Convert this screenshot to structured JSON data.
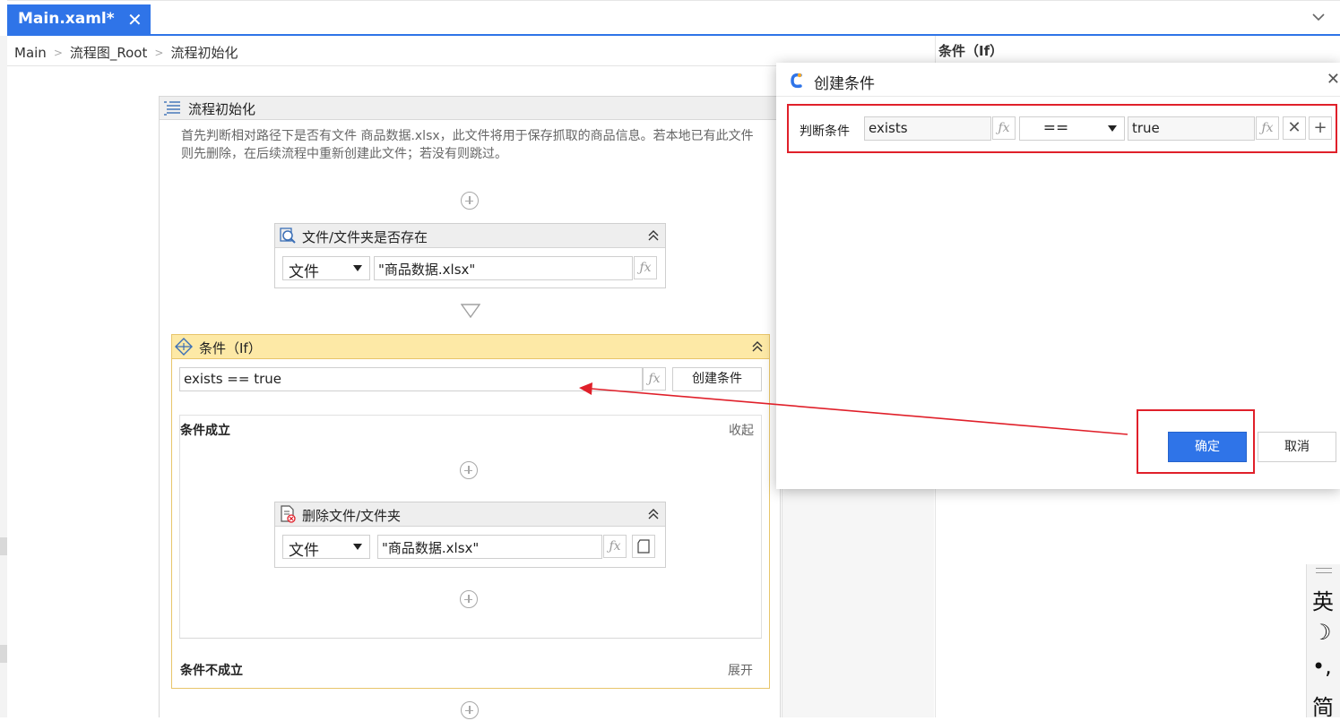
{
  "tab": {
    "title": "Main.xaml*",
    "close": "✕"
  },
  "breadcrumb": {
    "items": [
      "Main",
      "流程图_Root",
      "流程初始化"
    ]
  },
  "properties": {
    "title": "条件（If）"
  },
  "sequence": {
    "title": "流程初始化",
    "description": "首先判断相对路径下是否有文件 商品数据.xlsx，此文件将用于保存抓取的商品信息。若本地已有此文件则先删除，在后续流程中重新创建此文件；若没有则跳过。"
  },
  "file_exists": {
    "title": "文件/文件夹是否存在",
    "type": "文件",
    "path": "\"商品数据.xlsx\""
  },
  "if_activity": {
    "title": "条件（If）",
    "condition": "exists == true",
    "create_button": "创建条件",
    "then_label": "条件成立",
    "then_toggle": "收起",
    "else_label": "条件不成立",
    "else_toggle": "展开"
  },
  "delete_file": {
    "title": "删除文件/文件夹",
    "type": "文件",
    "path": "\"商品数据.xlsx\""
  },
  "fx_label": "ƒx",
  "dialog": {
    "title": "创建条件",
    "close": "✕",
    "condition_label": "判断条件",
    "left": "exists",
    "operator": "==",
    "right": "true",
    "remove": "✕",
    "add": "+",
    "ok": "确定",
    "cancel": "取消"
  },
  "ime": {
    "chars": [
      "英",
      "☽",
      "•,",
      "简"
    ]
  },
  "colors": {
    "accent": "#2f74e8",
    "highlight": "#e0202a",
    "if_header": "#fde9a6"
  }
}
